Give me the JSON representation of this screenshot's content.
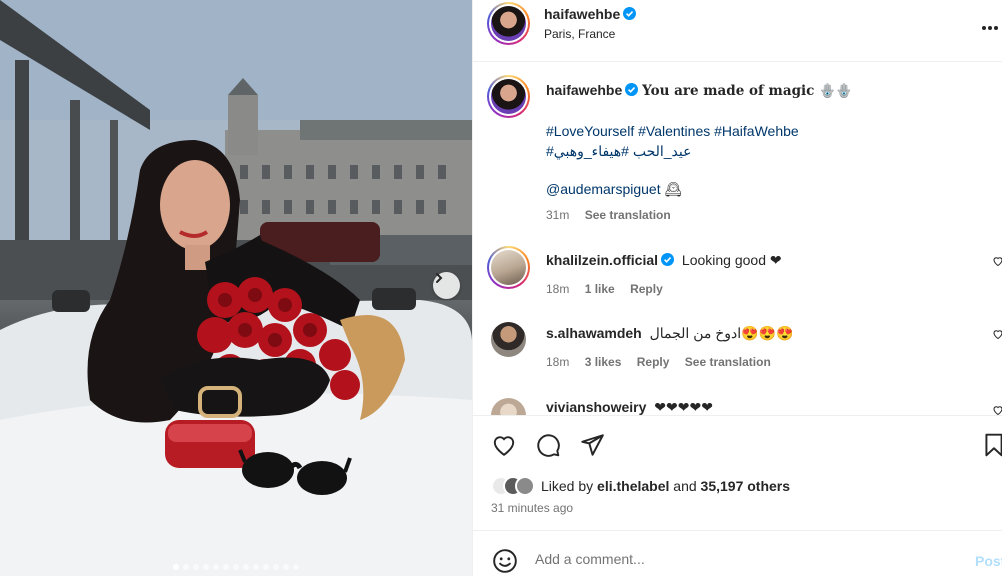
{
  "post": {
    "username": "haifawehbe",
    "location": "Paris, France",
    "verified": true,
    "carousel": {
      "slide_count": 13,
      "active_index": 0
    }
  },
  "caption": {
    "username": "haifawehbe",
    "headline": "You are made of magic 🪬🪬",
    "hashtags_line1": "#LoveYourself #Valentines #HaifaWehbe",
    "hashtags_line2": "#عيد_الحب #هيفاء_وهبي",
    "mention": "@audemarspiguet",
    "mention_suffix": "🕰",
    "time": "31m",
    "see_translation": "See translation"
  },
  "comments": [
    {
      "username": "khalilzein.official",
      "verified": true,
      "text": "Looking good ❤",
      "time": "18m",
      "likes": "1 like",
      "reply": "Reply",
      "see_translation": ""
    },
    {
      "username": "s.alhawamdeh",
      "verified": false,
      "text": "ادوخ من الجمال😍😍😍",
      "time": "18m",
      "likes": "3 likes",
      "reply": "Reply",
      "see_translation": "See translation"
    },
    {
      "username": "vivianshoweiry",
      "verified": false,
      "text": "❤❤❤❤❤",
      "time": "",
      "likes": "",
      "reply": "",
      "see_translation": ""
    }
  ],
  "likes": {
    "prefix": "Liked by",
    "user": "eli.thelabel",
    "connector": "and",
    "others": "35,197 others",
    "time_ago": "31 minutes ago"
  },
  "add_comment": {
    "placeholder": "Add a comment...",
    "post_label": "Post"
  },
  "icons": {
    "like": "heart-icon",
    "comment": "comment-icon",
    "share": "paper-plane-icon",
    "save": "bookmark-icon",
    "emoji": "smiley-icon",
    "more": "more-dots-icon",
    "next": "chevron-right-icon",
    "verified": "verified-badge-icon"
  },
  "colors": {
    "link": "#00376b",
    "verified": "#0095f6",
    "muted": "#737373",
    "post_disabled": "#b2dffc"
  }
}
